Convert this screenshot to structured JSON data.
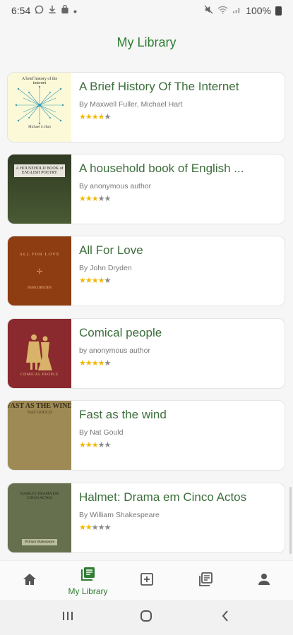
{
  "status_bar": {
    "time": "6:54",
    "battery": "100%",
    "left_icons": [
      "whatsapp-icon",
      "download-icon",
      "bag-icon",
      "dot-icon"
    ],
    "right_icons": [
      "mute-icon",
      "wifi-icon",
      "signal-icon",
      "battery-icon"
    ]
  },
  "app_bar": {
    "title": "My Library"
  },
  "books": [
    {
      "title": "A Brief History Of The Internet",
      "author": "By Maxwell Fuller, Michael Hart",
      "rating": 4,
      "cover_text": "A brief history of the internet",
      "cover_sub": "Michael S. Hart",
      "cover_color": "#fbf9d8"
    },
    {
      "title": "A household book of English ...",
      "author": "By anonymous author",
      "rating": 3,
      "cover_text": "A HOUSEHOLD BOOK of ENGLISH POETRY",
      "cover_sub": "",
      "cover_color": "#3d4b2c"
    },
    {
      "title": "All For Love",
      "author": "By  John Dryden",
      "rating": 4,
      "cover_text": "ALL FOR LOVE",
      "cover_sub": "JOHN DRYDEN",
      "cover_color": "#8e3c12"
    },
    {
      "title": "Comical people",
      "author": "by anonymous author",
      "rating": 4,
      "cover_text": "",
      "cover_sub": "COMICAL PEOPLE",
      "cover_color": "#8a2a2e"
    },
    {
      "title": "Fast as the wind",
      "author": "By Nat Gould",
      "rating": 3,
      "cover_text": "FAST AS THE WIND",
      "cover_sub": "NAT GOULD",
      "cover_color": "#9e8a55"
    },
    {
      "title": "Halmet: Drama em Cinco Actos",
      "author": "By William Shakespeare",
      "rating": 2,
      "cover_text": "HAMLET DRAMA EM CINCO ACTOS",
      "cover_sub": "William Shakespeare",
      "cover_color": "#66704f"
    }
  ],
  "bottom_nav": [
    {
      "label": "",
      "icon": "home-icon",
      "active": false
    },
    {
      "label": "My Library",
      "icon": "library-icon",
      "active": true
    },
    {
      "label": "",
      "icon": "add-box-icon",
      "active": false
    },
    {
      "label": "",
      "icon": "reading-list-icon",
      "active": false
    },
    {
      "label": "",
      "icon": "profile-icon",
      "active": false
    }
  ],
  "colors": {
    "accent": "#2e7d32",
    "title": "#3c6e3c",
    "star": "#f2b705"
  }
}
